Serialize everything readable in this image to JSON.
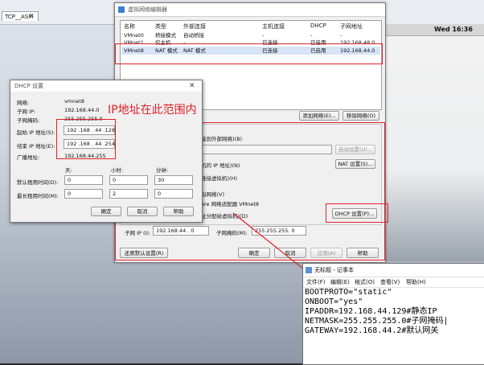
{
  "vm_tab": {
    "label": "TCP__ASM",
    "close": "✕"
  },
  "clock": "Wed 16:36",
  "editor": {
    "title": "虚拟网络编辑器",
    "columns": [
      "名称",
      "类型",
      "外部连接",
      "主机连接",
      "DHCP",
      "子网地址"
    ],
    "rows": [
      {
        "name": "VMnet0",
        "type": "桥接模式",
        "external": "自动桥接",
        "host": "-",
        "dhcp": "-",
        "subnet": "-"
      },
      {
        "name": "VMnet1",
        "type": "仅主机...",
        "external": "-",
        "host": "已连接",
        "dhcp": "已启用",
        "subnet": "192.168.48.0"
      },
      {
        "name": "VMnet8",
        "type": "NAT 模式",
        "external": "NAT 模式",
        "host": "已连接",
        "dhcp": "已启用",
        "subnet": "192.168.44.0"
      }
    ],
    "add_network": "添加网络(E)...",
    "remove_network": "移除网络(O)",
    "bridge_label": "接到外部网络)(B)",
    "auto_settings": "自动设置(U)...",
    "nat_label": "机的 IP 地址)(N)",
    "nat_settings": "NAT 设置(S)...",
    "hostonly_label": "连接虚拟机)(H)",
    "connect_adapter": "拟网络(V)",
    "adapter_name": "are 网络适配器 VMnet8",
    "dhcp_label": "址分配给虚拟机)(D)",
    "dhcp_settings": "DHCP 设置(P)...",
    "subnet_ip_label": "子网 IP (I):",
    "subnet_ip": "192.168.44 . 0",
    "subnet_mask_label": "子网掩码(M):",
    "subnet_mask": "255.255.255. 0",
    "restore_defaults": "还原默认设置(R)",
    "ok": "确定",
    "cancel": "取消",
    "apply": "应用(A)",
    "help": "帮助"
  },
  "dhcp": {
    "title": "DHCP 设置",
    "network_label": "网络:",
    "network": "vmnet8",
    "subnet_ip_label": "子网 IP:",
    "subnet_ip": "192.168.44.0",
    "mask_label": "子网掩码:",
    "mask": "255.255.255.0",
    "start_label": "起始 IP 地址(S):",
    "start": "192 .168 . 44 .128",
    "end_label": "结束 IP 地址(E):",
    "end": "192 .168 . 44 .254",
    "broadcast_label": "广播地址:",
    "broadcast": "192.168.44.255",
    "days": "天:",
    "hours": "小时:",
    "minutes": "分钟:",
    "default_lease_label": "默认租用时间(D):",
    "default_lease": [
      "0",
      "0",
      "30"
    ],
    "max_lease_label": "最长租用时间(M):",
    "max_lease": [
      "0",
      "2",
      "0"
    ],
    "ok": "确定",
    "cancel": "取消",
    "help": "帮助"
  },
  "annotation": "IP地址在此范围内",
  "notepad": {
    "title": "无标题 - 记事本",
    "menu": [
      "文件(F)",
      "编辑(E)",
      "格式(O)",
      "查看(V)",
      "帮助(H)"
    ],
    "lines": [
      "BOOTPROTO=\"static\"",
      "ONBOOT=\"yes\"",
      "IPADDR=192.168.44.129#静态IP",
      "NETMASK=255.255.255.0#子网掩码|",
      "GATEWAY=192.168.44.2#默认网关"
    ]
  },
  "colors": {
    "annotation": "#e0202a",
    "selection": "#d7e4f7"
  }
}
